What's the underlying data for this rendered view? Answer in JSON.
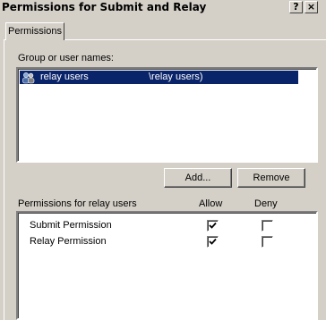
{
  "window": {
    "title": "Permissions for Submit and Relay",
    "help_button": "?",
    "close_button": "×"
  },
  "tabs": [
    {
      "label": "Permissions"
    }
  ],
  "group_section": {
    "label": "Group or user names:",
    "users": [
      {
        "name": "relay users",
        "account": "\\relay users)",
        "selected": true
      }
    ]
  },
  "buttons": {
    "add": "Add...",
    "remove": "Remove"
  },
  "permissions_section": {
    "label": "Permissions for relay users",
    "allow_header": "Allow",
    "deny_header": "Deny",
    "rows": [
      {
        "name": "Submit Permission",
        "allow": true,
        "deny": false
      },
      {
        "name": "Relay Permission",
        "allow": true,
        "deny": false
      }
    ]
  }
}
